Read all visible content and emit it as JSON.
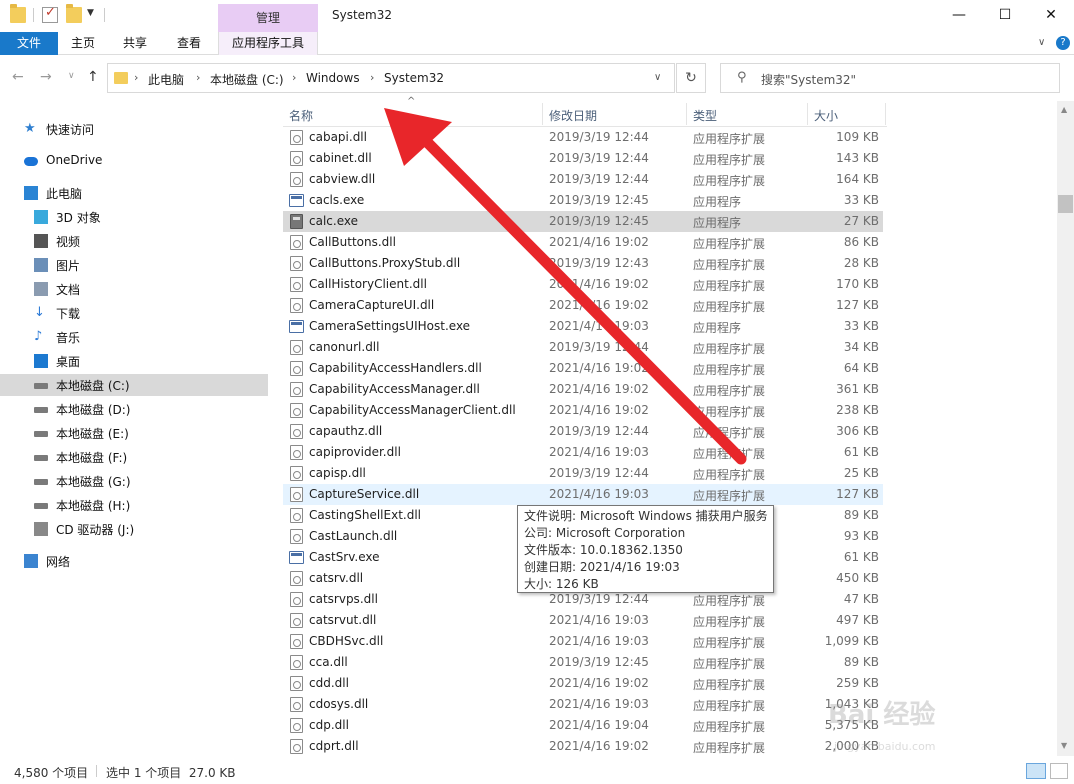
{
  "window": {
    "title": "System32",
    "manage_tab": "管理",
    "controls": {
      "minimize": "—",
      "maximize": "☐",
      "close": "✕"
    }
  },
  "ribbon": {
    "tabs": [
      "文件",
      "主页",
      "共享",
      "查看",
      "应用程序工具"
    ],
    "help": "?"
  },
  "address": {
    "breadcrumbs": [
      "此电脑",
      "本地磁盘 (C:)",
      "Windows",
      "System32"
    ],
    "search_placeholder": "搜索\"System32\""
  },
  "nav": [
    {
      "label": "快速访问",
      "icon": "star-icon"
    },
    {
      "label": "OneDrive",
      "icon": "cloud-icon"
    },
    {
      "label": "此电脑",
      "icon": "computer-icon"
    },
    {
      "label": "3D 对象",
      "icon": "cube-icon"
    },
    {
      "label": "视频",
      "icon": "video-icon"
    },
    {
      "label": "图片",
      "icon": "picture-icon"
    },
    {
      "label": "文档",
      "icon": "document-icon"
    },
    {
      "label": "下载",
      "icon": "download-icon"
    },
    {
      "label": "音乐",
      "icon": "music-icon"
    },
    {
      "label": "桌面",
      "icon": "desktop-icon"
    },
    {
      "label": "本地磁盘 (C:)",
      "icon": "drive-icon"
    },
    {
      "label": "本地磁盘 (D:)",
      "icon": "drive-icon"
    },
    {
      "label": "本地磁盘 (E:)",
      "icon": "drive-icon"
    },
    {
      "label": "本地磁盘 (F:)",
      "icon": "drive-icon"
    },
    {
      "label": "本地磁盘 (G:)",
      "icon": "drive-icon"
    },
    {
      "label": "本地磁盘 (H:)",
      "icon": "drive-icon"
    },
    {
      "label": "CD 驱动器 (J:)",
      "icon": "cd-drive-icon"
    },
    {
      "label": "网络",
      "icon": "network-icon"
    }
  ],
  "columns": {
    "name": "名称",
    "date": "修改日期",
    "type": "类型",
    "size": "大小"
  },
  "files": [
    {
      "name": "cabapi.dll",
      "date": "2019/3/19 12:44",
      "type": "应用程序扩展",
      "size": "109 KB",
      "kind": "dll"
    },
    {
      "name": "cabinet.dll",
      "date": "2019/3/19 12:44",
      "type": "应用程序扩展",
      "size": "143 KB",
      "kind": "dll"
    },
    {
      "name": "cabview.dll",
      "date": "2019/3/19 12:44",
      "type": "应用程序扩展",
      "size": "164 KB",
      "kind": "dll"
    },
    {
      "name": "cacls.exe",
      "date": "2019/3/19 12:45",
      "type": "应用程序",
      "size": "33 KB",
      "kind": "exe"
    },
    {
      "name": "calc.exe",
      "date": "2019/3/19 12:45",
      "type": "应用程序",
      "size": "27 KB",
      "kind": "calc"
    },
    {
      "name": "CallButtons.dll",
      "date": "2021/4/16 19:02",
      "type": "应用程序扩展",
      "size": "86 KB",
      "kind": "dll"
    },
    {
      "name": "CallButtons.ProxyStub.dll",
      "date": "2019/3/19 12:43",
      "type": "应用程序扩展",
      "size": "28 KB",
      "kind": "dll"
    },
    {
      "name": "CallHistoryClient.dll",
      "date": "2021/4/16 19:02",
      "type": "应用程序扩展",
      "size": "170 KB",
      "kind": "dll"
    },
    {
      "name": "CameraCaptureUI.dll",
      "date": "2021/4/16 19:02",
      "type": "应用程序扩展",
      "size": "127 KB",
      "kind": "dll"
    },
    {
      "name": "CameraSettingsUIHost.exe",
      "date": "2021/4/16 19:03",
      "type": "应用程序",
      "size": "33 KB",
      "kind": "exe"
    },
    {
      "name": "canonurl.dll",
      "date": "2019/3/19 12:44",
      "type": "应用程序扩展",
      "size": "34 KB",
      "kind": "dll"
    },
    {
      "name": "CapabilityAccessHandlers.dll",
      "date": "2021/4/16 19:02",
      "type": "应用程序扩展",
      "size": "64 KB",
      "kind": "dll"
    },
    {
      "name": "CapabilityAccessManager.dll",
      "date": "2021/4/16 19:02",
      "type": "应用程序扩展",
      "size": "361 KB",
      "kind": "dll"
    },
    {
      "name": "CapabilityAccessManagerClient.dll",
      "date": "2021/4/16 19:02",
      "type": "应用程序扩展",
      "size": "238 KB",
      "kind": "dll"
    },
    {
      "name": "capauthz.dll",
      "date": "2019/3/19 12:44",
      "type": "应用程序扩展",
      "size": "306 KB",
      "kind": "dll"
    },
    {
      "name": "capiprovider.dll",
      "date": "2021/4/16 19:03",
      "type": "应用程序扩展",
      "size": "61 KB",
      "kind": "dll"
    },
    {
      "name": "capisp.dll",
      "date": "2019/3/19 12:44",
      "type": "应用程序扩展",
      "size": "25 KB",
      "kind": "dll"
    },
    {
      "name": "CaptureService.dll",
      "date": "2021/4/16 19:03",
      "type": "应用程序扩展",
      "size": "127 KB",
      "kind": "dll"
    },
    {
      "name": "CastingShellExt.dll",
      "date": "",
      "type": "",
      "size": "89 KB",
      "kind": "dll"
    },
    {
      "name": "CastLaunch.dll",
      "date": "",
      "type": "",
      "size": "93 KB",
      "kind": "dll"
    },
    {
      "name": "CastSrv.exe",
      "date": "",
      "type": "",
      "size": "61 KB",
      "kind": "exe"
    },
    {
      "name": "catsrv.dll",
      "date": "",
      "type": "",
      "size": "450 KB",
      "kind": "dll"
    },
    {
      "name": "catsrvps.dll",
      "date": "2019/3/19 12:44",
      "type": "应用程序扩展",
      "size": "47 KB",
      "kind": "dll"
    },
    {
      "name": "catsrvut.dll",
      "date": "2021/4/16 19:03",
      "type": "应用程序扩展",
      "size": "497 KB",
      "kind": "dll"
    },
    {
      "name": "CBDHSvc.dll",
      "date": "2021/4/16 19:03",
      "type": "应用程序扩展",
      "size": "1,099 KB",
      "kind": "dll"
    },
    {
      "name": "cca.dll",
      "date": "2019/3/19 12:45",
      "type": "应用程序扩展",
      "size": "89 KB",
      "kind": "dll"
    },
    {
      "name": "cdd.dll",
      "date": "2021/4/16 19:02",
      "type": "应用程序扩展",
      "size": "259 KB",
      "kind": "dll"
    },
    {
      "name": "cdosys.dll",
      "date": "2021/4/16 19:03",
      "type": "应用程序扩展",
      "size": "1,043 KB",
      "kind": "dll"
    },
    {
      "name": "cdp.dll",
      "date": "2021/4/16 19:04",
      "type": "应用程序扩展",
      "size": "5,375 KB",
      "kind": "dll"
    },
    {
      "name": "cdprt.dll",
      "date": "2021/4/16 19:02",
      "type": "应用程序扩展",
      "size": "2,000 KB",
      "kind": "dll"
    }
  ],
  "selected_index": 4,
  "hover_index": 17,
  "tooltip": [
    "文件说明: Microsoft Windows 捕获用户服务",
    "公司: Microsoft Corporation",
    "文件版本: 10.0.18362.1350",
    "创建日期: 2021/4/16 19:03",
    "大小: 126 KB"
  ],
  "status": {
    "count": "4,580 个项目",
    "selection": "选中 1 个项目  27.0 KB"
  },
  "watermark": {
    "text": "Bai 经验",
    "url": "jingyan.baidu.com"
  },
  "colors": {
    "accent": "#1979ca",
    "manage_tab": "#e8ccf4",
    "arrow": "#e8262a",
    "selection": "#d9d9d9",
    "hover": "#e5f3ff"
  }
}
